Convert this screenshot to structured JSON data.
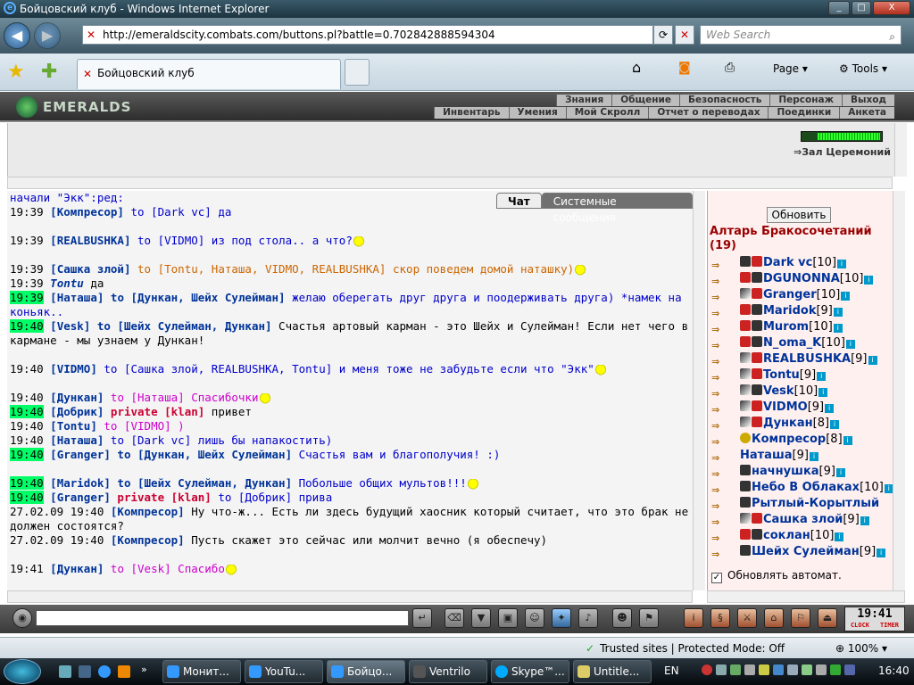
{
  "window": {
    "title": "Бойцовский клуб - Windows Internet Explorer",
    "minimize": "_",
    "maximize": "□",
    "close": "X"
  },
  "address": {
    "url": "http://emeraldscity.combats.com/buttons.pl?battle=0.702842888594304",
    "search_placeholder": "Web Search"
  },
  "tab": {
    "title": "Бойцовский клуб"
  },
  "ie_toolbar": {
    "page": "Page",
    "tools": "Tools"
  },
  "game": {
    "logo": "EMERALDS",
    "menu_top": [
      "Знания",
      "Общение",
      "Безопасность",
      "Персонаж",
      "Выход"
    ],
    "menu_bottom": [
      "Инвентарь",
      "Умения",
      "Мой Скролл",
      "Отчет о переводах",
      "Поединки",
      "Анкета"
    ],
    "room_link": "Зал Церемоний",
    "chat_tabs": {
      "chat": "Чат",
      "system": "Системные сообщения"
    }
  },
  "chat": {
    "first_line": "начали \"Экк\":ред:",
    "messages": [
      {
        "time": "19:39",
        "hl": false,
        "nick": "[Компресор]",
        "to": " to [Dark vc]",
        "text": " да",
        "color": "to",
        "gap": false
      },
      {
        "time": "19:39",
        "hl": false,
        "nick": "[REALBUSHKA]",
        "to": " to [VIDMO]",
        "text": " из под стола.. а что?",
        "color": "to",
        "gap": true
      },
      {
        "time": "19:39",
        "hl": false,
        "nick": "[Сашка злой]",
        "to": " to [Tontu, Наташа, VIDMO, REALBUSHKA]",
        "text": " скор поведем домой наташку)",
        "color": "orange",
        "gap": true
      },
      {
        "time": "19:39",
        "hl": false,
        "nick": "Tontu",
        "to": "",
        "text": " да",
        "color": "italic",
        "gap": false
      },
      {
        "time": "19:39",
        "hl": true,
        "nick": "[Наташа]",
        "to": " to [Дункан, Шейх Сулейман]",
        "text": " желаю оберегать друг друга и поодерживать друга) *намек на коньяк..",
        "color": "bold-to",
        "gap": false
      },
      {
        "time": "19:40",
        "hl": true,
        "nick": "[Vesk]",
        "to": " to [Шейх Сулейман, Дункан]",
        "text": " Счастья артовый карман - это Шейх и Сулейман! Если нет чего в кармане - мы узнаем у Дункан!",
        "color": "bold-black",
        "gap": false
      },
      {
        "time": "19:40",
        "hl": false,
        "nick": "[VIDMO]",
        "to": " to [Сашка злой, REALBUSHKA, Tontu]",
        "text": " и меня тоже не забудьте если что \"Экк\"",
        "color": "to",
        "gap": true
      },
      {
        "time": "19:40",
        "hl": false,
        "nick": "[Дункан]",
        "to": " to [Наташа]",
        "text": " Спасибочки",
        "color": "pink",
        "gap": true
      },
      {
        "time": "19:40",
        "hl": true,
        "nick": "[Добрик]",
        "to": " private [klan]",
        "text": " привет",
        "color": "priv",
        "gap": false
      },
      {
        "time": "19:40",
        "hl": false,
        "nick": "[Tontu]",
        "to": " to [VIDMO]",
        "text": " )",
        "color": "pink",
        "gap": false
      },
      {
        "time": "19:40",
        "hl": false,
        "nick": "[Наташа]",
        "to": " to [Dark vc]",
        "text": " лишь бы напакостить)",
        "color": "to",
        "gap": false
      },
      {
        "time": "19:40",
        "hl": true,
        "nick": "[Granger]",
        "to": " to [Дункан, Шейх Сулейман]",
        "text": " Счастья вам и благополучия! :)",
        "color": "bold-to",
        "gap": false
      },
      {
        "time": "19:40",
        "hl": true,
        "nick": "[Maridok]",
        "to": " to [Шейх Сулейман, Дункан]",
        "text": " Побольше общих мультов!!!",
        "color": "bold-to",
        "gap": true
      },
      {
        "time": "19:40",
        "hl": true,
        "nick": "[Granger]",
        "to": " private [klan]",
        "text": " to [Добрик] прива",
        "color": "priv2",
        "gap": false
      },
      {
        "time": "27.02.09 19:40",
        "hl": false,
        "nick": "[Компресор]",
        "to": "",
        "text": " Ну что-ж... Есть ли здесь будущий хаосник который считает, что это брак не должен состоятся?",
        "color": "black",
        "gap": false
      },
      {
        "time": "27.02.09 19:40",
        "hl": false,
        "nick": "[Компресор]",
        "to": "",
        "text": " Пусть скажет это сейчас или молчит вечно (я обеспечу)",
        "color": "black",
        "gap": false
      },
      {
        "time": "19:41",
        "hl": false,
        "nick": "[Дункан]",
        "to": " to [Vesk]",
        "text": " Спасибо",
        "color": "pink",
        "gap": true
      }
    ]
  },
  "room": {
    "refresh_label": "Обновить",
    "name": "Алтарь Бракосочетаний (19)",
    "auto_refresh_label": "Обновлять автомат.",
    "auto_refresh_checked": "✓",
    "users": [
      {
        "name": "Dark vc",
        "level": "[10]"
      },
      {
        "name": "DGUNONNA",
        "level": "[10]"
      },
      {
        "name": "Granger",
        "level": "[10]"
      },
      {
        "name": "Maridok",
        "level": "[9]"
      },
      {
        "name": "Murom",
        "level": "[10]"
      },
      {
        "name": "N_oma_K",
        "level": "[10]"
      },
      {
        "name": "REALBUSHKA",
        "level": "[9]"
      },
      {
        "name": "Tontu",
        "level": "[9]"
      },
      {
        "name": "Vesk",
        "level": "[10]"
      },
      {
        "name": "VIDMO",
        "level": "[9]"
      },
      {
        "name": "Дункан",
        "level": "[8]"
      },
      {
        "name": "Компресор",
        "level": "[8]"
      },
      {
        "name": "Наташа",
        "level": "[9]"
      },
      {
        "name": "начнушка",
        "level": "[9]"
      },
      {
        "name": "Небо В Облаках",
        "level": "[10]"
      },
      {
        "name": "Рытлый-Корытлый",
        "level": ""
      },
      {
        "name": "Сашка злой",
        "level": "[9]"
      },
      {
        "name": "соклан",
        "level": "[10]"
      },
      {
        "name": "Шейх Сулейман",
        "level": "[9]"
      }
    ]
  },
  "clock": {
    "time": "19:41",
    "clock_label": "CLOCK",
    "timer_label": "TIMER"
  },
  "status": {
    "trusted": "Trusted sites | Protected Mode: Off",
    "zoom": "100%"
  },
  "taskbar": {
    "items": [
      "Монит...",
      "YouTu...",
      "Бойцо...",
      "Ventrilo",
      "Skype™...",
      "Untitle..."
    ],
    "lang": "EN",
    "time": "16:40"
  }
}
